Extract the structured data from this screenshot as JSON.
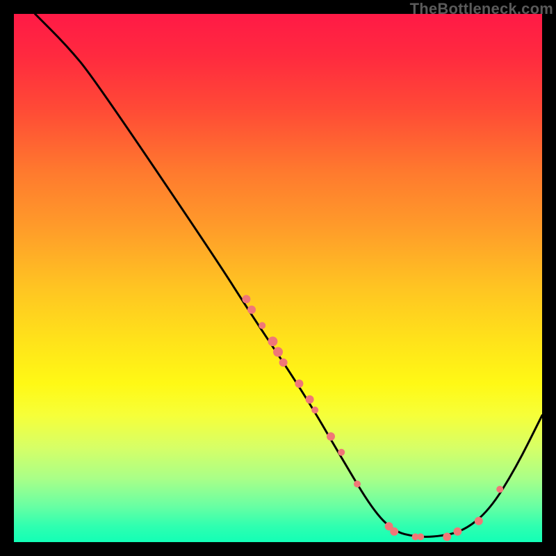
{
  "watermark": "TheBottleneck.com",
  "colors": {
    "curve_stroke": "#000000",
    "dot_fill": "#f07777",
    "gradient_top": "#ff1a46",
    "gradient_bottom": "#12ffb6"
  },
  "chart_data": {
    "type": "line",
    "title": "",
    "xlabel": "",
    "ylabel": "",
    "xlim": [
      0,
      100
    ],
    "ylim": [
      0,
      100
    ],
    "grid": false,
    "legend": false,
    "curve": [
      {
        "x": 4,
        "y": 100
      },
      {
        "x": 10,
        "y": 94
      },
      {
        "x": 15,
        "y": 88
      },
      {
        "x": 38,
        "y": 54
      },
      {
        "x": 45,
        "y": 43
      },
      {
        "x": 55,
        "y": 28
      },
      {
        "x": 62,
        "y": 16
      },
      {
        "x": 68,
        "y": 6
      },
      {
        "x": 72,
        "y": 2
      },
      {
        "x": 76,
        "y": 1
      },
      {
        "x": 80,
        "y": 1
      },
      {
        "x": 85,
        "y": 2
      },
      {
        "x": 90,
        "y": 6
      },
      {
        "x": 95,
        "y": 14
      },
      {
        "x": 100,
        "y": 24
      }
    ],
    "dots": [
      {
        "x": 44,
        "y": 46,
        "r": 6
      },
      {
        "x": 45,
        "y": 44,
        "r": 6
      },
      {
        "x": 47,
        "y": 41,
        "r": 5
      },
      {
        "x": 49,
        "y": 38,
        "r": 7
      },
      {
        "x": 50,
        "y": 36,
        "r": 7
      },
      {
        "x": 51,
        "y": 34,
        "r": 6
      },
      {
        "x": 54,
        "y": 30,
        "r": 6
      },
      {
        "x": 56,
        "y": 27,
        "r": 6
      },
      {
        "x": 57,
        "y": 25,
        "r": 5
      },
      {
        "x": 60,
        "y": 20,
        "r": 6
      },
      {
        "x": 62,
        "y": 17,
        "r": 5
      },
      {
        "x": 65,
        "y": 11,
        "r": 5
      },
      {
        "x": 71,
        "y": 3,
        "r": 6
      },
      {
        "x": 72,
        "y": 2,
        "r": 6
      },
      {
        "x": 76,
        "y": 1,
        "r": 5
      },
      {
        "x": 77,
        "y": 1,
        "r": 5
      },
      {
        "x": 82,
        "y": 1,
        "r": 6
      },
      {
        "x": 84,
        "y": 2,
        "r": 6
      },
      {
        "x": 88,
        "y": 4,
        "r": 6
      },
      {
        "x": 92,
        "y": 10,
        "r": 5
      }
    ]
  }
}
